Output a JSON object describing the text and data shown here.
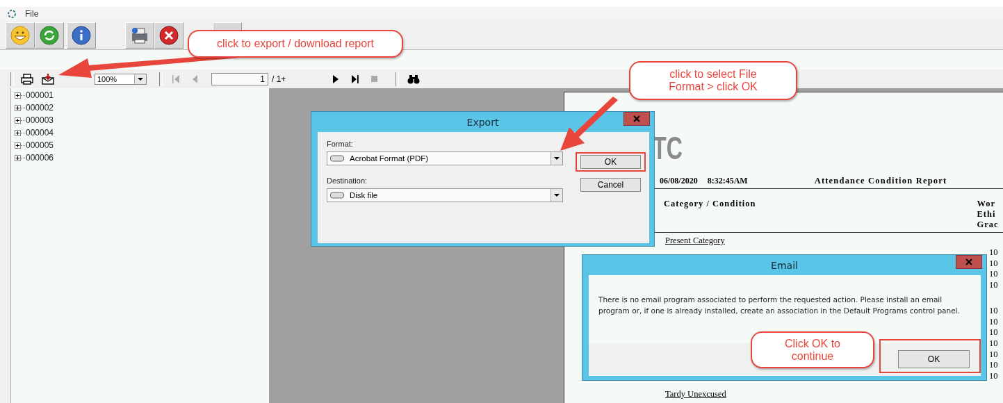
{
  "menu": {
    "items": [
      {
        "label": "File"
      }
    ]
  },
  "viewer_toolbar": {
    "zoom": "100%",
    "page": "1",
    "page_count": "/ 1+"
  },
  "tree": {
    "items": [
      {
        "label": "000001",
        "expanded": false
      },
      {
        "label": "000002",
        "expanded": false
      },
      {
        "label": "000003",
        "expanded": false
      },
      {
        "label": "000004",
        "expanded": false
      },
      {
        "label": "000005",
        "expanded": false
      },
      {
        "label": "000006",
        "expanded": false
      }
    ]
  },
  "report": {
    "logo": "TC",
    "date": "06/08/2020",
    "time": "8:32:45AM",
    "title": "Attendance Condition Report",
    "column_header": "Category / Condition",
    "column_2_header": [
      "Wor",
      "Ethi",
      "Grac"
    ],
    "category": "Present Category",
    "category_2": "Tardy Unexcused",
    "column_2_values": [
      "10",
      "10",
      "10",
      "10",
      "10",
      "10",
      "10",
      "10",
      "10",
      "10",
      "10"
    ]
  },
  "export_dialog": {
    "title": "Export",
    "format_label": "Format:",
    "format": "Acrobat Format (PDF)",
    "destination_label": "Destination:",
    "destination": "Disk file",
    "buttons": [
      {
        "label": "OK",
        "highlighted": true
      },
      {
        "label": "Cancel",
        "highlighted": false
      }
    ]
  },
  "email_dialog": {
    "title": "Email",
    "message": "There is no email program associated to perform the requested action. Please install an email program or, if one is already installed, create an association in the Default Programs control panel.",
    "button": {
      "label": "OK",
      "highlighted": true
    }
  },
  "callouts": [
    {
      "text": "click to export / download report"
    },
    {
      "text": "click to select File Format > click OK"
    },
    {
      "text": "Click OK to continue"
    }
  ]
}
